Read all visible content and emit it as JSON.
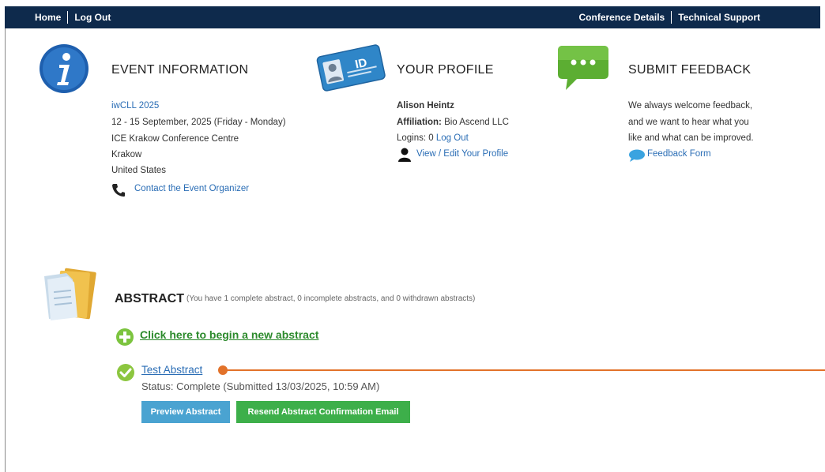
{
  "nav": {
    "home": "Home",
    "logout": "Log Out",
    "conference_details": "Conference Details",
    "technical_support": "Technical Support"
  },
  "event": {
    "title": "EVENT INFORMATION",
    "name": "iwCLL 2025",
    "dates": "12 - 15 September, 2025 (Friday - Monday)",
    "venue": "ICE Krakow Conference Centre",
    "city": "Krakow",
    "country": "United States",
    "contact_link": "Contact the Event Organizer"
  },
  "profile": {
    "title": "YOUR PROFILE",
    "name": "Alison Heintz",
    "affiliation_label": "Affiliation:",
    "affiliation_value": "Bio Ascend LLC",
    "logins_label": "Logins: 0",
    "logout_link": "Log Out",
    "edit_link": "View / Edit Your Profile",
    "id_badge_text": "ID"
  },
  "feedback": {
    "title": "SUBMIT FEEDBACK",
    "line1": "We always welcome feedback,",
    "line2": "and we want to hear what you",
    "line3": "like and what can be improved.",
    "form_link": "Feedback Form"
  },
  "abstract": {
    "title": "ABSTRACT",
    "summary": "(You have 1 complete abstract, 0 incomplete abstracts, and 0 withdrawn abstracts)",
    "new_link": "Click here to begin a new abstract",
    "item_title": "Test Abstract",
    "item_status": "Status: Complete (Submitted 13/03/2025, 10:59 AM)",
    "preview_button": "Preview Abstract",
    "resend_button": "Resend Abstract Confirmation Email"
  },
  "colors": {
    "topbar": "#0e2a4c",
    "link": "#2a6db5",
    "green_link": "#2c8a2c",
    "preview_button": "#4aa3d1",
    "resend_button": "#3daf4a",
    "callout": "#e2722a"
  }
}
